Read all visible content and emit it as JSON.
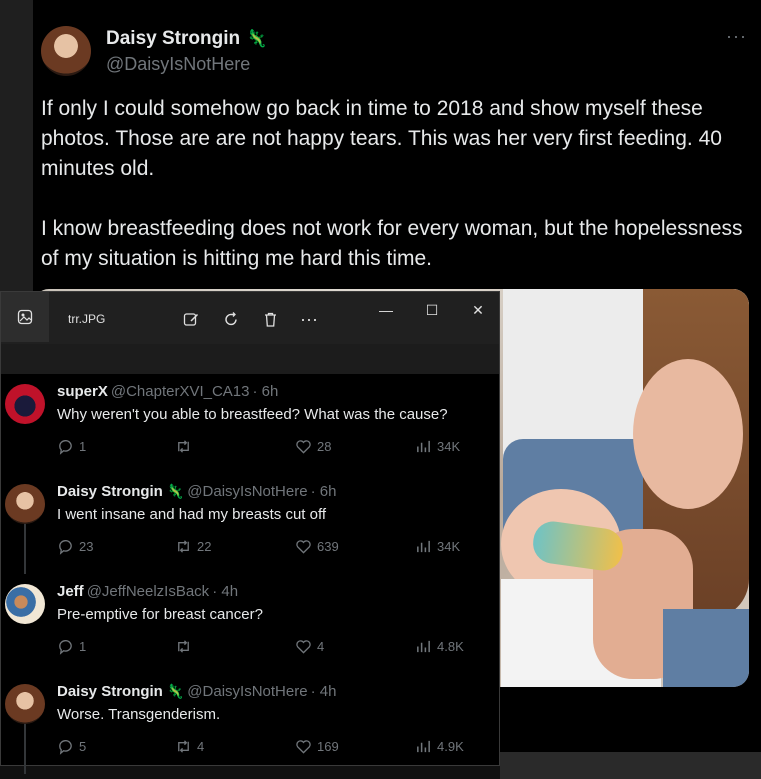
{
  "tweet": {
    "name": "Daisy Strongin",
    "badge": "🦎",
    "handle": "@DaisyIsNotHere",
    "more": "···",
    "paragraphs": [
      "If only I could somehow go back in time to 2018 and show myself these photos. Those are are not happy tears. This was her very first feeding. 40 minutes old.",
      "I know breastfeeding does not work for every woman, but the hopelessness of my situation is hitting me hard this time."
    ]
  },
  "window": {
    "file_name": "trr.JPG",
    "more_label": "···",
    "minimize": "—",
    "maximize": "☐",
    "close": "✕"
  },
  "replies": [
    {
      "name": "superX",
      "badge": "",
      "handle": "@ChapterXVI_CA13",
      "time": "· 6h",
      "text": "Why weren't you able to breastfeed? What was the cause?",
      "replies": "1",
      "reposts": "",
      "likes": "28",
      "views": "34K",
      "avatar": "superx"
    },
    {
      "name": "Daisy Strongin",
      "badge": "🦎",
      "handle": "@DaisyIsNotHere",
      "time": "· 6h",
      "text": "I went insane and had my breasts cut off",
      "replies": "23",
      "reposts": "22",
      "likes": "639",
      "views": "34K",
      "avatar": "daisy"
    },
    {
      "name": "Jeff",
      "badge": "",
      "handle": "@JeffNeelzIsBack",
      "time": "· 4h",
      "text": "Pre-emptive for breast cancer?",
      "replies": "1",
      "reposts": "",
      "likes": "4",
      "views": "4.8K",
      "avatar": "jeff"
    },
    {
      "name": "Daisy Strongin",
      "badge": "🦎",
      "handle": "@DaisyIsNotHere",
      "time": "· 4h",
      "text": "Worse. Transgenderism.",
      "replies": "5",
      "reposts": "4",
      "likes": "169",
      "views": "4.9K",
      "avatar": "daisy"
    }
  ],
  "colors": {
    "background": "#000000",
    "text": "#e7e9ea",
    "muted": "#71767b",
    "badge": "#4caf50"
  }
}
